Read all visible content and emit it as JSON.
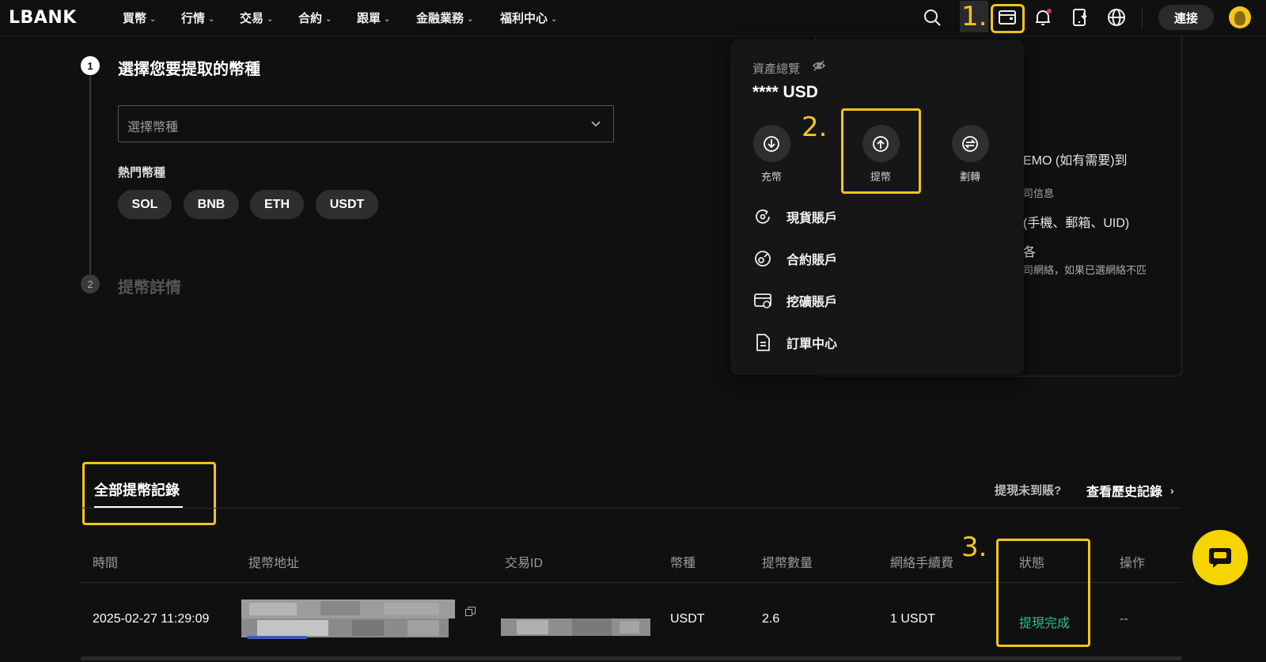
{
  "brand": {
    "logo_text": "LBANK",
    "accent": "#f5c518",
    "success": "#2ebd85"
  },
  "nav": {
    "items": [
      {
        "label": "買幣"
      },
      {
        "label": "行情"
      },
      {
        "label": "交易"
      },
      {
        "label": "合約"
      },
      {
        "label": "跟單"
      },
      {
        "label": "金融業務"
      },
      {
        "label": "福利中心"
      }
    ],
    "connect_label": "連接",
    "icons": [
      "search-icon",
      "wallet-icon",
      "bell-icon",
      "download-app-icon",
      "globe-icon"
    ]
  },
  "annotations": {
    "step1": "1.",
    "step2": "2.",
    "step3": "3."
  },
  "steps": {
    "step1": {
      "number": "1",
      "title": "選擇您要提取的幣種"
    },
    "step2": {
      "number": "2",
      "title": "提幣詳情"
    }
  },
  "coin_select": {
    "placeholder": "選擇幣種",
    "hot_label": "熱門幣種",
    "hot_coins": [
      "SOL",
      "BNB",
      "ETH",
      "USDT"
    ]
  },
  "side_card_peek": {
    "line1": "EMO (如有需要)到",
    "line2": "司信息",
    "line3": "(手機、郵箱、UID)",
    "line4": "各",
    "line5": "司網絡，如果已選網絡不匹"
  },
  "wallet_dropdown": {
    "title": "資產總覽",
    "balance": "**** USD",
    "actions": [
      {
        "label": "充幣"
      },
      {
        "label": "提幣"
      },
      {
        "label": "劃轉"
      }
    ],
    "menu": [
      {
        "label": "現貨賬戶"
      },
      {
        "label": "合約賬戶"
      },
      {
        "label": "挖礦賬戶"
      },
      {
        "label": "訂單中心"
      }
    ]
  },
  "records": {
    "tab_label": "全部提幣記錄",
    "not_arrived": "提現未到賬?",
    "history_link": "查看歷史記錄",
    "columns": [
      "時間",
      "提幣地址",
      "交易ID",
      "幣種",
      "提幣數量",
      "網絡手續費",
      "狀態",
      "操作"
    ],
    "rows": [
      {
        "time": "2025-02-27 11:29:09",
        "coin": "USDT",
        "amount": "2.6",
        "fee": "1 USDT",
        "status": "提現完成",
        "action": "--"
      }
    ]
  }
}
